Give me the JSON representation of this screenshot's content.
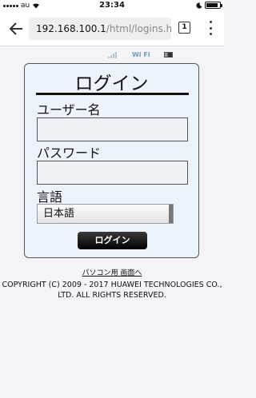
{
  "status_bar": {
    "carrier": "au",
    "time": "23:34",
    "battery_level": 0.9
  },
  "browser": {
    "url_host": "192.168.100.1",
    "url_path": "/html/logins.htm",
    "tab_count": "1"
  },
  "device_indicators": {
    "wifi_label": "Wi Fi"
  },
  "login": {
    "title": "ログイン",
    "username_label": "ユーザー名",
    "username_value": "",
    "password_label": "パスワード",
    "password_value": "",
    "language_label": "言語",
    "language_selected": "日本語",
    "login_button": "ログイン"
  },
  "footer": {
    "pc_view_link": "パソコン用 画面へ",
    "copyright": "COPYRIGHT (C) 2009 - 2017 HUAWEI TECHNOLOGIES CO., LTD. ALL RIGHTS RESERVED."
  }
}
